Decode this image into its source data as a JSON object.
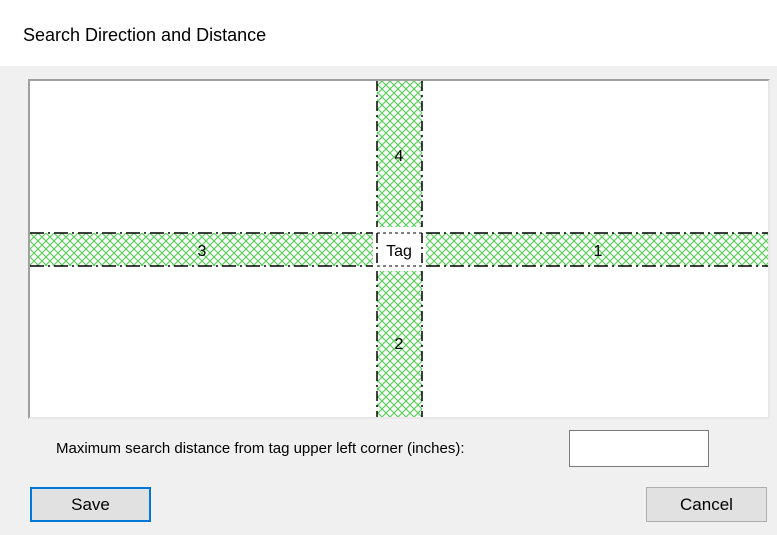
{
  "window": {
    "title": "Search Direction and Distance"
  },
  "diagram": {
    "tag_label": "Tag",
    "zones": [
      {
        "id": "right",
        "label": "1"
      },
      {
        "id": "bottom",
        "label": "2"
      },
      {
        "id": "left",
        "label": "3"
      },
      {
        "id": "top",
        "label": "4"
      }
    ],
    "zone_fill_color": "#6bd46b",
    "boundary_color": "#000000"
  },
  "distance": {
    "label": "Maximum search distance from tag upper left corner (inches):",
    "value": "",
    "placeholder": ""
  },
  "buttons": {
    "save": "Save",
    "cancel": "Cancel"
  },
  "colors": {
    "focus_border": "#0078d7",
    "window_bg": "#f0f0f0"
  }
}
